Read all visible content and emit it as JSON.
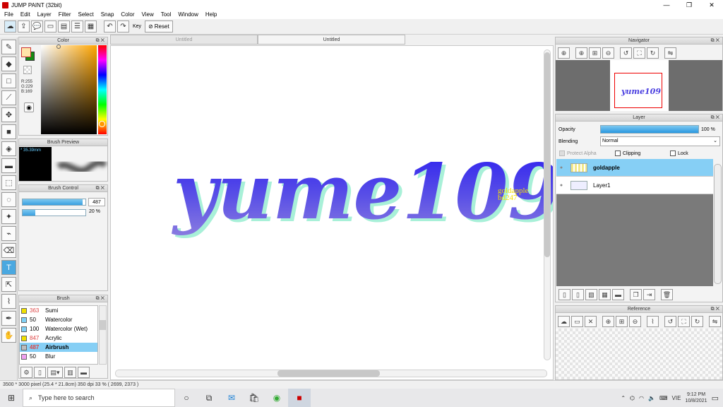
{
  "app": {
    "title": "JUMP PAINT (32bit)"
  },
  "window_controls": {
    "minimize": "—",
    "restore": "❐",
    "close": "✕"
  },
  "menu": [
    "File",
    "Edit",
    "Layer",
    "Filter",
    "Select",
    "Snap",
    "Color",
    "View",
    "Tool",
    "Window",
    "Help"
  ],
  "toolbar": {
    "key_label": "Key",
    "reset_label": "Reset"
  },
  "tabs": [
    "Untitled",
    "Untitled"
  ],
  "color_panel": {
    "title": "Color",
    "readout": [
      "R:255",
      "G:229",
      "B:169"
    ],
    "fg_color": "#ffe5a9",
    "bg_color": "#138a13"
  },
  "brush_preview": {
    "title": "Brush Preview",
    "size_label": "* 35.39mm"
  },
  "brush_control": {
    "title": "Brush Control",
    "size_value": "487",
    "opacity_value": "20 %",
    "size_fraction": 0.95,
    "opacity_fraction": 0.2
  },
  "brush_list": {
    "title": "Brush",
    "items": [
      {
        "size": "363",
        "name": "Sumi",
        "color": "#f0e000",
        "size_color": "#d44"
      },
      {
        "size": "50",
        "name": "Watercolor",
        "color": "#7fd0f5",
        "size_color": "#000"
      },
      {
        "size": "100",
        "name": "Watercolor (Wet)",
        "color": "#7fd0f5",
        "size_color": "#000"
      },
      {
        "size": "847",
        "name": "Acrylic",
        "color": "#f0e000",
        "size_color": "#d44"
      },
      {
        "size": "487",
        "name": "Airbrush",
        "color": "#bbbbbb",
        "size_color": "#d44",
        "selected": true
      },
      {
        "size": "50",
        "name": "Blur",
        "color": "#f0a0f0",
        "size_color": "#000"
      }
    ]
  },
  "canvas": {
    "artwork_text": "yume109",
    "side_note_line1": "goldapple",
    "side_note_line2": "bd247"
  },
  "navigator": {
    "title": "Navigator",
    "thumb_text": "yume109"
  },
  "layer_panel": {
    "title": "Layer",
    "opacity_label": "Opacity",
    "opacity_value": "100 %",
    "opacity_fraction": 1.0,
    "blending_label": "Blending",
    "blending_value": "Normal",
    "protect_alpha": "Protect Alpha",
    "clipping": "Clipping",
    "lock": "Lock",
    "layers": [
      {
        "name": "goldapple",
        "selected": true
      },
      {
        "name": "Layer1",
        "selected": false
      }
    ]
  },
  "reference": {
    "title": "Reference"
  },
  "status": {
    "text": "3500 * 3000 pixel   (25.4 * 21.8cm)   350 dpi   33 %   ( 2699, 2373 )"
  },
  "taskbar": {
    "search_placeholder": "Type here to search",
    "lang": "VIE",
    "time": "9:12 PM",
    "date": "10/8/2021"
  }
}
